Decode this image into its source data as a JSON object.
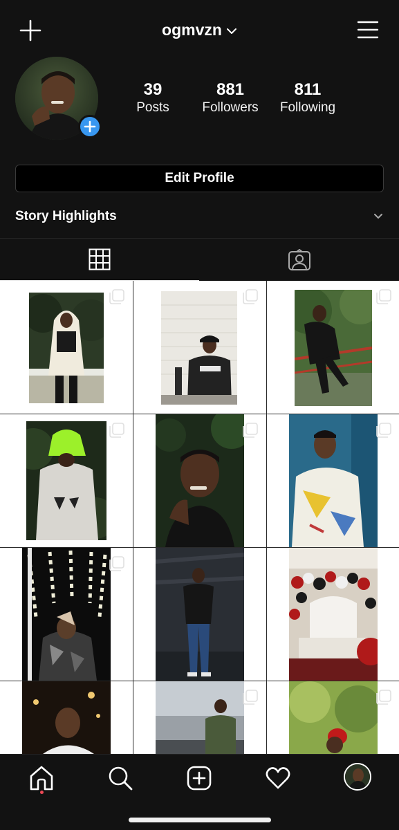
{
  "header": {
    "username": "ogmvzn",
    "new_post_icon": "plus-icon",
    "menu_icon": "hamburger-menu-icon"
  },
  "profile": {
    "stats": [
      {
        "value": "39",
        "label": "Posts"
      },
      {
        "value": "881",
        "label": "Followers"
      },
      {
        "value": "811",
        "label": "Following"
      }
    ],
    "edit_profile_label": "Edit Profile",
    "story_highlights_label": "Story Highlights"
  },
  "tabs": {
    "grid_icon": "grid-icon",
    "tagged_icon": "tagged-person-icon",
    "active": "grid"
  },
  "posts": [
    {
      "desc": "man in white hoodie outdoors",
      "multiple": true
    },
    {
      "desc": "man in black hoodie against white wall",
      "multiple": true
    },
    {
      "desc": "man sitting on railing by water",
      "multiple": true
    },
    {
      "desc": "man in neon green cap",
      "multiple": true
    },
    {
      "desc": "man with hand near mouth",
      "multiple": true
    },
    {
      "desc": "man in colorful t-shirt",
      "multiple": true
    },
    {
      "desc": "man under lights in parking garage",
      "multiple": true
    },
    {
      "desc": "man standing in parking garage",
      "multiple": false
    },
    {
      "desc": "party decorations with balloons",
      "multiple": false
    },
    {
      "desc": "man at night with lights",
      "multiple": false
    },
    {
      "desc": "man outdoors under cloudy sky",
      "multiple": true
    },
    {
      "desc": "man with red cap under trees",
      "multiple": true
    }
  ],
  "bottom_nav": [
    {
      "name": "home",
      "icon": "home-icon",
      "active": true
    },
    {
      "name": "search",
      "icon": "search-icon"
    },
    {
      "name": "new-post",
      "icon": "add-post-icon"
    },
    {
      "name": "activity",
      "icon": "heart-icon"
    },
    {
      "name": "profile",
      "icon": "profile-avatar"
    }
  ],
  "colors": {
    "background": "#121212",
    "accent": "#3897f0",
    "notification": "#ed4956"
  }
}
